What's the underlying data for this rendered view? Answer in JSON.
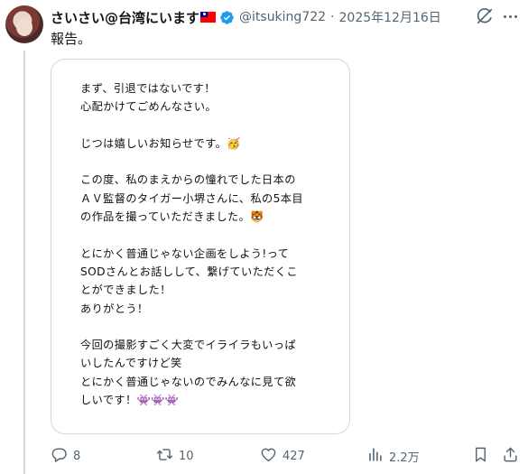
{
  "author": {
    "display_name": "さいさい@台湾にいます",
    "handle": "@itsuking722",
    "separator": "·",
    "date": "2025年12月16日"
  },
  "tweet": {
    "text": "報告。"
  },
  "media": {
    "lines": [
      "まず、引退ではないです！",
      "心配かけてごめんなさい。",
      "",
      "じつは嬉しいお知らせです。🥳",
      "",
      "この度、私のまえからの憧れでした日本の",
      "ＡＶ監督のタイガー小堺さんに、私の5本目",
      "の作品を撮っていただきました。🐯",
      "",
      "とにかく普通じゃない企画をしよう!って",
      "SODさんとお話しして、繋げていただくこ",
      "とができました！",
      "ありがとう！",
      "",
      "今回の撮影すごく大変でイライラもいっぱ",
      "いしたんですけど笑",
      "とにかく普通じゃないのでみんなに見て欲",
      "しいです！👾👾👾"
    ]
  },
  "actions": {
    "replies": "8",
    "reposts": "10",
    "likes": "427",
    "views": "2.2万"
  },
  "icons": {
    "verified": "verified-badge-icon",
    "grok": "grok-icon",
    "more": "more-icon",
    "reply": "reply-icon",
    "repost": "repost-icon",
    "like": "like-icon",
    "views": "views-icon",
    "bookmark": "bookmark-icon",
    "share": "share-icon"
  },
  "colors": {
    "verified": "#1d9bf0",
    "secondary_text": "#536471",
    "border": "#cfd9de"
  }
}
